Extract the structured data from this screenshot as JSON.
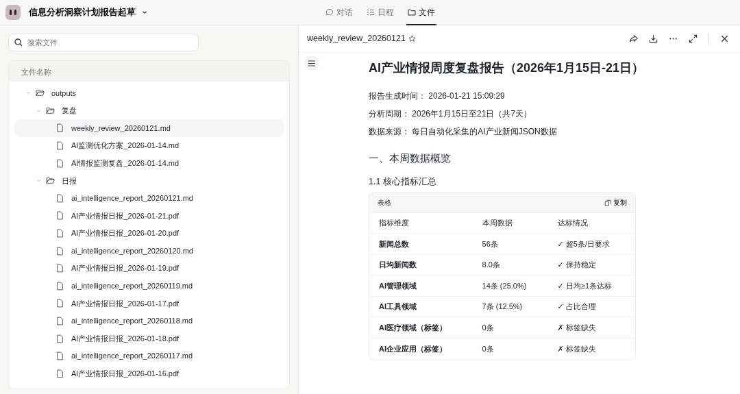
{
  "app": {
    "title": "信息分析洞察计划报告起草"
  },
  "tabs": [
    {
      "label": "对话",
      "kind": "chat",
      "selected": false
    },
    {
      "label": "日程",
      "kind": "schedule",
      "selected": false
    },
    {
      "label": "文件",
      "kind": "folder",
      "selected": true
    }
  ],
  "sidebar": {
    "search": {
      "placeholder": "搜索文件"
    },
    "header": "文件名称",
    "tree": [
      {
        "name": "outputs",
        "kind": "folder",
        "expanded": true,
        "children": [
          {
            "name": "复盘",
            "kind": "folder",
            "expanded": true,
            "children": [
              {
                "name": "weekly_review_20260121.md",
                "kind": "file",
                "selected": true
              },
              {
                "name": "AI监测优化方案_2026-01-14.md",
                "kind": "file",
                "selected": false
              },
              {
                "name": "AI情报监测复盘_2026-01-14.md",
                "kind": "file",
                "selected": false
              }
            ]
          },
          {
            "name": "日报",
            "kind": "folder",
            "expanded": true,
            "children": [
              {
                "name": "ai_intelligence_report_20260121.md",
                "kind": "file",
                "selected": false
              },
              {
                "name": "AI产业情报日报_2026-01-21.pdf",
                "kind": "file",
                "selected": false
              },
              {
                "name": "AI产业情报日报_2026-01-20.pdf",
                "kind": "file",
                "selected": false
              },
              {
                "name": "ai_intelligence_report_20260120.md",
                "kind": "file",
                "selected": false
              },
              {
                "name": "AI产业情报日报_2026-01-19.pdf",
                "kind": "file",
                "selected": false
              },
              {
                "name": "ai_intelligence_report_20260119.md",
                "kind": "file",
                "selected": false
              },
              {
                "name": "AI产业情报日报_2026-01-17.pdf",
                "kind": "file",
                "selected": false
              },
              {
                "name": "ai_intelligence_report_20260118.md",
                "kind": "file",
                "selected": false
              },
              {
                "name": "AI产业情报日报_2026-01-18.pdf",
                "kind": "file",
                "selected": false
              },
              {
                "name": "ai_intelligence_report_20260117.md",
                "kind": "file",
                "selected": false
              },
              {
                "name": "AI产业情报日报_2026-01-16.pdf",
                "kind": "file",
                "selected": false
              }
            ]
          }
        ]
      }
    ]
  },
  "viewer": {
    "filename": "weekly_review_20260121",
    "document": {
      "title": "AI产业情报周度复盘报告（2026年1月15日-21日）",
      "meta": [
        {
          "label": "报告生成时间：",
          "value": "2026-01-21 15:09:29"
        },
        {
          "label": "分析周期：",
          "value": "2026年1月15日至21日（共7天）"
        },
        {
          "label": "数据来源：",
          "value": "每日自动化采集的AI产业新闻JSON数据"
        }
      ],
      "section": "一、本周数据概览",
      "subsection": "1.1 核心指标汇总",
      "table": {
        "caption": "表格",
        "copy_label": "复制",
        "columns": [
          "指标维度",
          "本周数据",
          "达标情况"
        ],
        "rows": [
          [
            "新闻总数",
            "56条",
            "✓ 超5条/日要求"
          ],
          [
            "日均新闻数",
            "8.0条",
            "✓ 保持稳定"
          ],
          [
            "AI管理领域",
            "14条 (25.0%)",
            "✓ 日均≥1条达标"
          ],
          [
            "AI工具领域",
            "7条 (12.5%)",
            "✓ 占比合理"
          ],
          [
            "AI医疗领域（标签）",
            "0条",
            "✗ 标签缺失"
          ],
          [
            "AI企业应用（标签）",
            "0条",
            "✗ 标签缺失"
          ]
        ]
      }
    }
  }
}
